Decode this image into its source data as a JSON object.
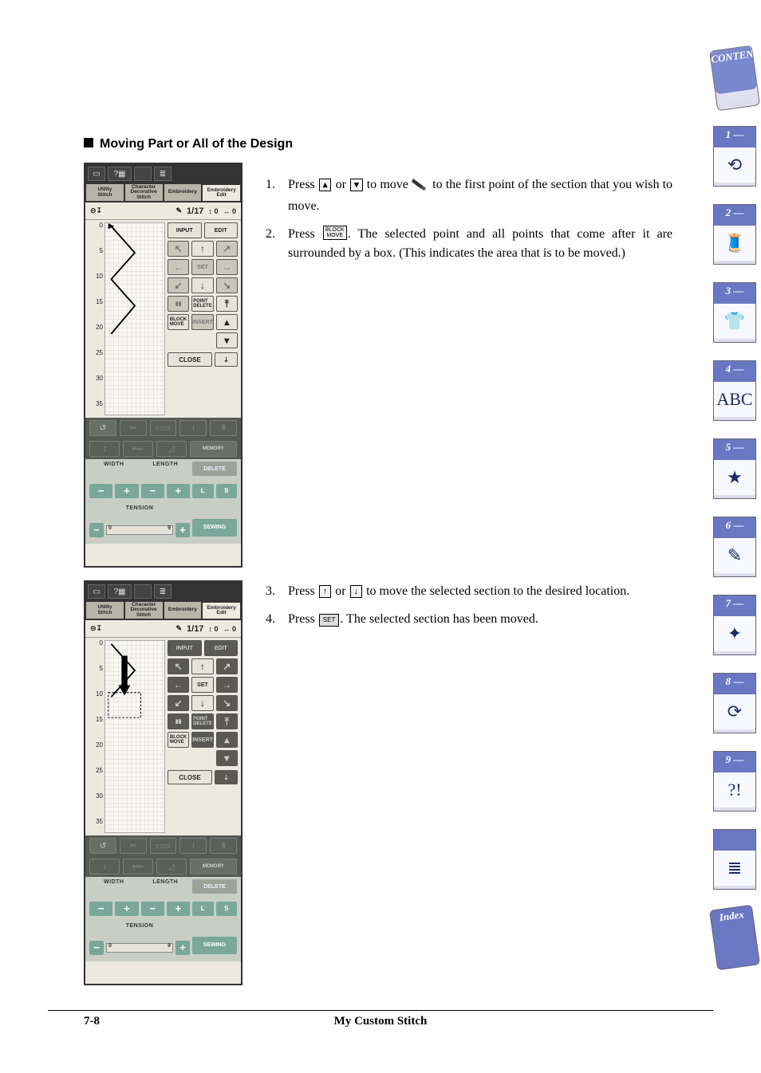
{
  "heading": "Moving Part or All of the Design",
  "steps_a": [
    {
      "num": "1.",
      "pre": "Press",
      "key1": "▴",
      "mid1": "or",
      "key2": "▾",
      "mid2": "to move",
      "post": "to the first point of the section that you wish to move."
    },
    {
      "num": "2.",
      "pre": "Press",
      "key1": "BLOCK\nMOVE",
      "post": ". The selected point and all points that come after it are surrounded by a box. (This indicates the area that is to be moved.)"
    }
  ],
  "steps_b": [
    {
      "num": "3.",
      "pre": "Press",
      "key1": "↑",
      "mid1": "or",
      "key2": "↓",
      "post": "to move the selected section to the desired location."
    },
    {
      "num": "4.",
      "pre": "Press",
      "key1": "SET",
      "post": ". The selected section has been moved."
    }
  ],
  "side_tabs": [
    {
      "label": "CONTENTS",
      "type": "contents"
    },
    {
      "label": "1 —",
      "icon": "⟲"
    },
    {
      "label": "2 —",
      "icon": "🧵"
    },
    {
      "label": "3 —",
      "icon": "👕"
    },
    {
      "label": "4 —",
      "icon": "ABC"
    },
    {
      "label": "5 —",
      "icon": "★"
    },
    {
      "label": "6 —",
      "icon": "✎"
    },
    {
      "label": "7 —",
      "icon": "✦"
    },
    {
      "label": "8 —",
      "icon": "⟳"
    },
    {
      "label": "9 —",
      "icon": "?!"
    },
    {
      "label": "",
      "icon": "≣"
    },
    {
      "label": "Index",
      "type": "index"
    }
  ],
  "screen": {
    "tabs": [
      "Utility\nStitch",
      "Character\nDecorative\nStitch",
      "Embroidery",
      "Embroidery\nEdit"
    ],
    "active_tab": 3,
    "status": {
      "frac_top": "1",
      "frac_bot": "17",
      "h": "0",
      "w": "0"
    },
    "ruler": [
      "0",
      "5",
      "10",
      "15",
      "20",
      "25",
      "30",
      "35"
    ],
    "btns": {
      "row1": [
        "INPUT",
        "EDIT"
      ],
      "arrows_diag": [
        "↖",
        "↑",
        "↗"
      ],
      "arrows_mid": [
        "←",
        "SET",
        "→"
      ],
      "arrows_low": [
        "↙",
        "↓",
        "↘"
      ],
      "row_misc": [
        "▮▮",
        "POINT\nDELETE",
        "⤒"
      ],
      "row_bm": [
        "BLOCK\nMOVE",
        "INSERT",
        "▴"
      ],
      "row_down": [
        "▾"
      ],
      "close": "CLOSE",
      "last": "⇣"
    },
    "toolrow1": [
      "↺",
      "✂",
      "▭▭",
      "⟊",
      "⦀"
    ],
    "toolrow2": [
      "↕",
      "⟸",
      "◿",
      "MEMORY"
    ],
    "adjust": {
      "width": "WIDTH",
      "length": "LENGTH",
      "delete": "DELETE",
      "tension": "TENSION",
      "l": "L",
      "s": "S",
      "sewing": "SEWING"
    }
  },
  "footer": {
    "page": "7-8",
    "title": "My Custom Stitch"
  }
}
